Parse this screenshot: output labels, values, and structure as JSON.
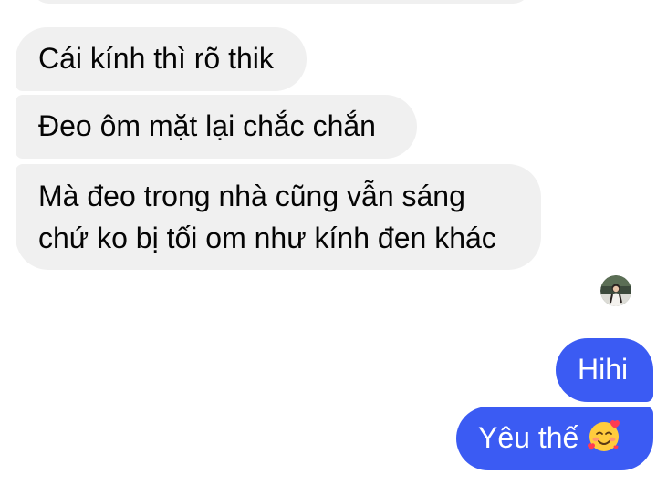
{
  "conversation": {
    "messages": [
      {
        "sender": "other",
        "text": "Cái kính thì rõ thik"
      },
      {
        "sender": "other",
        "text": "Đeo ôm mặt lại chắc chắn"
      },
      {
        "sender": "other",
        "lines": [
          "Mà đeo trong nhà cũng vẫn sáng",
          "chứ ko bị tối om như kính đen khác"
        ]
      },
      {
        "sender": "me",
        "text": "Hihi"
      },
      {
        "sender": "me",
        "text": "Yêu thế",
        "emoji": "smiling-face-with-hearts-icon"
      }
    ],
    "seen_indicator": {
      "icon": "user-avatar-icon"
    }
  },
  "colors": {
    "incoming_bubble": "#f0f0f0",
    "incoming_text": "#050505",
    "outgoing_bubble": "#3b5bf3",
    "outgoing_text": "#ffffff",
    "background": "#ffffff"
  }
}
